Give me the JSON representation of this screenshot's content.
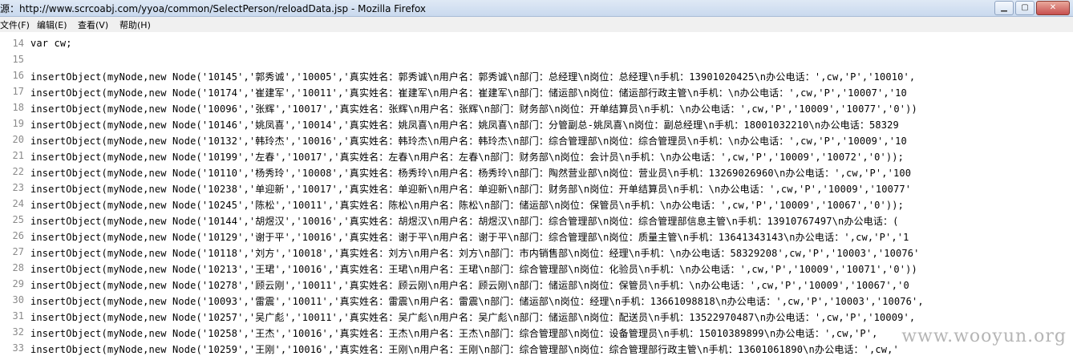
{
  "window": {
    "title": "源：http://www.scrcoabj.com/yyoa/common/SelectPerson/reloadData.jsp - Mozilla Firefox",
    "buttons": [
      "▁",
      "▢",
      "✕"
    ]
  },
  "menubar": {
    "file": "文件(F)",
    "edit": "编辑(E)",
    "view": "查看(V)",
    "help": "帮助(H)"
  },
  "source_lines": [
    {
      "num": "14",
      "text": "var cw;"
    },
    {
      "num": "15",
      "text": ""
    },
    {
      "num": "16",
      "text": "insertObject(myNode,new Node('10145','郭秀诚','10005','真实姓名：郭秀诚\\n用户名：郭秀诚\\n部门：总经理\\n岗位：总经理\\n手机：13901020425\\n办公电话：',cw,'P','10010',"
    },
    {
      "num": "17",
      "text": "insertObject(myNode,new Node('10174','崔建军','10011','真实姓名：崔建军\\n用户名：崔建军\\n部门：储运部\\n岗位：储运部行政主管\\n手机：\\n办公电话：',cw,'P','10007','10"
    },
    {
      "num": "18",
      "text": "insertObject(myNode,new Node('10096','张辉','10017','真实姓名：张辉\\n用户名：张辉\\n部门：财务部\\n岗位：开单结算员\\n手机：\\n办公电话：',cw,'P','10009','10077','0'))"
    },
    {
      "num": "19",
      "text": "insertObject(myNode,new Node('10146','姚凤喜','10014','真实姓名：姚凤喜\\n用户名：姚凤喜\\n部门：分管副总-姚凤喜\\n岗位：副总经理\\n手机：18001032210\\n办公电话：58329"
    },
    {
      "num": "20",
      "text": "insertObject(myNode,new Node('10132','韩玲杰','10016','真实姓名：韩玲杰\\n用户名：韩玲杰\\n部门：综合管理部\\n岗位：综合管理员\\n手机：\\n办公电话：',cw,'P','10009','10"
    },
    {
      "num": "21",
      "text": "insertObject(myNode,new Node('10199','左春','10017','真实姓名：左春\\n用户名：左春\\n部门：财务部\\n岗位：会计员\\n手机：\\n办公电话：',cw,'P','10009','10072','0'));"
    },
    {
      "num": "22",
      "text": "insertObject(myNode,new Node('10110','杨秀玲','10008','真实姓名：杨秀玲\\n用户名：杨秀玲\\n部门：陶然营业部\\n岗位：营业员\\n手机：13269026960\\n办公电话：',cw,'P','100"
    },
    {
      "num": "23",
      "text": "insertObject(myNode,new Node('10238','单迎新','10017','真实姓名：单迎新\\n用户名：单迎新\\n部门：财务部\\n岗位：开单结算员\\n手机：\\n办公电话：',cw,'P','10009','10077'"
    },
    {
      "num": "24",
      "text": "insertObject(myNode,new Node('10245','陈松','10011','真实姓名：陈松\\n用户名：陈松\\n部门：储运部\\n岗位：保管员\\n手机：\\n办公电话：',cw,'P','10009','10067','0'));"
    },
    {
      "num": "25",
      "text": "insertObject(myNode,new Node('10144','胡煜汉','10016','真实姓名：胡煜汉\\n用户名：胡煜汉\\n部门：综合管理部\\n岗位：综合管理部信息主管\\n手机：13910767497\\n办公电话：("
    },
    {
      "num": "26",
      "text": "insertObject(myNode,new Node('10129','谢于平','10016','真实姓名：谢于平\\n用户名：谢于平\\n部门：综合管理部\\n岗位：质量主管\\n手机：13641343143\\n办公电话：',cw,'P','1"
    },
    {
      "num": "27",
      "text": "insertObject(myNode,new Node('10118','刘方','10018','真实姓名：刘方\\n用户名：刘方\\n部门：市内销售部\\n岗位：经理\\n手机：\\n办公电话：58329208',cw,'P','10003','10076'"
    },
    {
      "num": "28",
      "text": "insertObject(myNode,new Node('10213','王珺','10016','真实姓名：王珺\\n用户名：王珺\\n部门：综合管理部\\n岗位：化验员\\n手机：\\n办公电话：',cw,'P','10009','10071','0'))"
    },
    {
      "num": "29",
      "text": "insertObject(myNode,new Node('10278','顾云刚','10011','真实姓名：顾云刚\\n用户名：顾云刚\\n部门：储运部\\n岗位：保管员\\n手机：\\n办公电话：',cw,'P','10009','10067','0"
    },
    {
      "num": "30",
      "text": "insertObject(myNode,new Node('10093','雷震','10011','真实姓名：雷震\\n用户名：雷震\\n部门：储运部\\n岗位：经理\\n手机：13661098818\\n办公电话：',cw,'P','10003','10076',"
    },
    {
      "num": "31",
      "text": "insertObject(myNode,new Node('10257','吴广彪','10011','真实姓名：吴广彪\\n用户名：吴广彪\\n部门：储运部\\n岗位：配送员\\n手机：13522970487\\n办公电话：',cw,'P','10009',"
    },
    {
      "num": "32",
      "text": "insertObject(myNode,new Node('10258','王杰','10016','真实姓名：王杰\\n用户名：王杰\\n部门：综合管理部\\n岗位：设备管理员\\n手机：15010389899\\n办公电话：',cw,'P',"
    },
    {
      "num": "33",
      "text": "insertObject(myNode,new Node('10259','王刚','10016','真实姓名：王刚\\n用户名：王刚\\n部门：综合管理部\\n岗位：综合管理部行政主管\\n手机：13601061890\\n办公电话：',cw,'"
    }
  ],
  "watermark": "www.wooyun.org"
}
